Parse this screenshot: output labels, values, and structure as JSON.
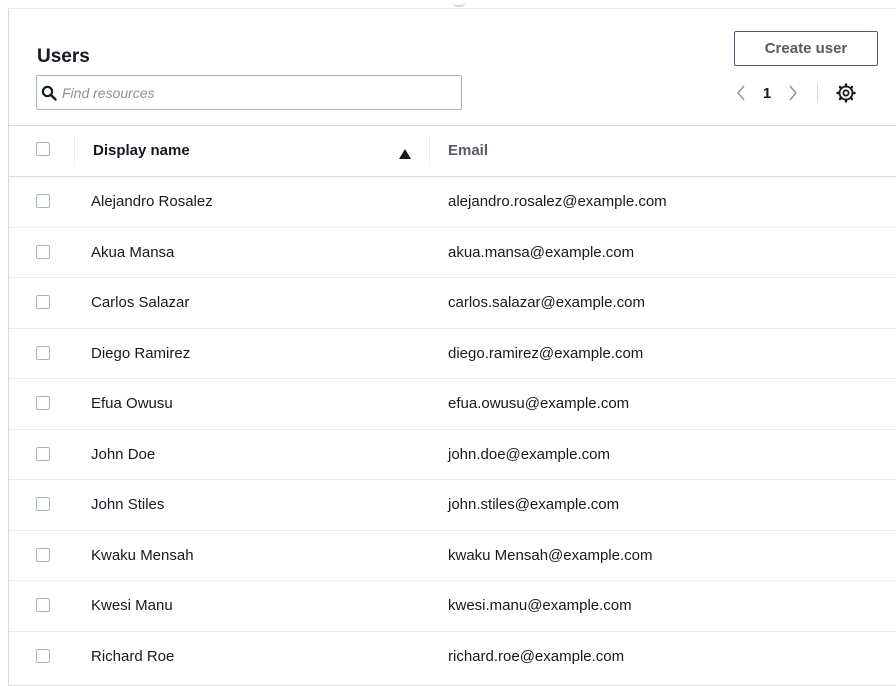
{
  "header": {
    "title": "Users",
    "create_button_label": "Create user"
  },
  "search": {
    "placeholder": "Find resources",
    "value": ""
  },
  "pagination": {
    "current_page": "1"
  },
  "table": {
    "columns": [
      "Display name",
      "Email"
    ],
    "sort": {
      "column": "Display name",
      "direction": "ascending"
    },
    "rows": [
      {
        "name": "Alejandro Rosalez",
        "email": "alejandro.rosalez@example.com"
      },
      {
        "name": "Akua Mansa",
        "email": "akua.mansa@example.com"
      },
      {
        "name": "Carlos Salazar",
        "email": "carlos.salazar@example.com"
      },
      {
        "name": "Diego Ramirez",
        "email": "diego.ramirez@example.com"
      },
      {
        "name": "Efua Owusu",
        "email": "efua.owusu@example.com"
      },
      {
        "name": "John Doe",
        "email": "john.doe@example.com"
      },
      {
        "name": "John Stiles",
        "email": "john.stiles@example.com"
      },
      {
        "name": "Kwaku Mensah",
        "email": "kwaku Mensah@example.com"
      },
      {
        "name": "Kwesi Manu",
        "email": "kwesi.manu@example.com"
      },
      {
        "name": "Richard Roe",
        "email": "richard.roe@example.com"
      }
    ]
  },
  "icons": {
    "search": "search-icon",
    "prev": "chevron-left-icon",
    "next": "chevron-right-icon",
    "settings": "settings-gear-icon",
    "sort": "sort-ascending-icon"
  },
  "colors": {
    "text": "#16191f",
    "muted": "#545b64",
    "border": "#d5dbdb",
    "placeholder": "#879596"
  }
}
